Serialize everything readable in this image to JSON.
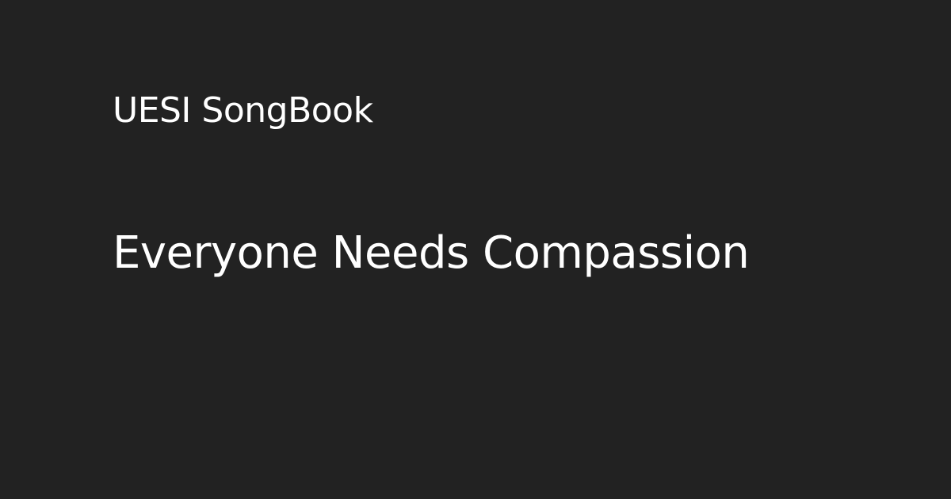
{
  "site": {
    "name": "UESI SongBook"
  },
  "song": {
    "title": "Everyone Needs Compassion"
  },
  "colors": {
    "background": "#222222",
    "text": "#ffffff"
  }
}
